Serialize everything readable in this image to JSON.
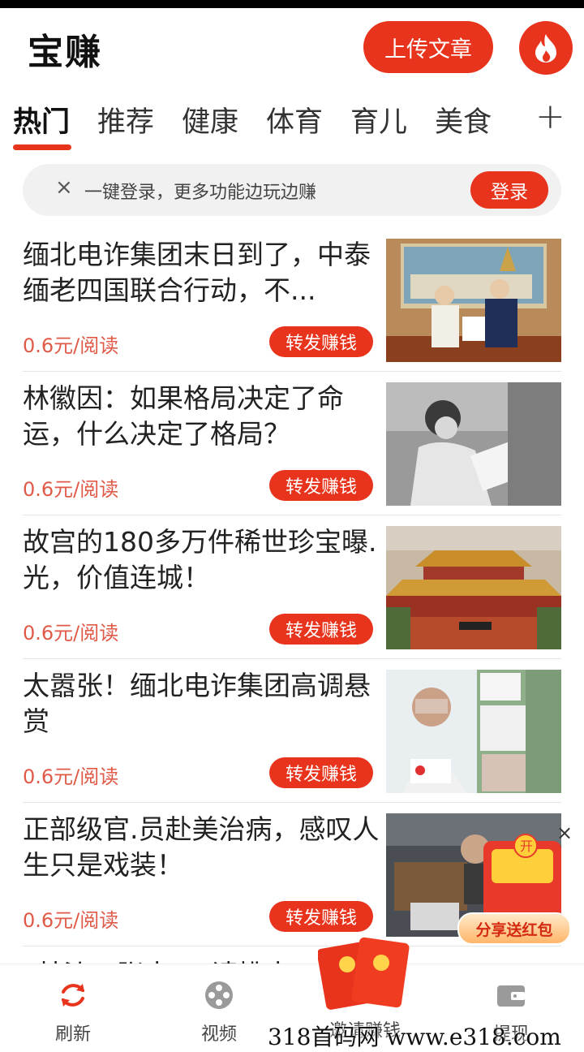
{
  "app": {
    "title": "宝赚",
    "upload_label": "上传文章",
    "accent": "#e8341c"
  },
  "tabs": [
    {
      "label": "热门",
      "active": true
    },
    {
      "label": "推荐"
    },
    {
      "label": "健康"
    },
    {
      "label": "体育"
    },
    {
      "label": "育儿"
    },
    {
      "label": "美食"
    }
  ],
  "tab_add": "+",
  "login_banner": {
    "close": "×",
    "text": "一键登录，更多功能边玩边赚",
    "button": "登录"
  },
  "feed": [
    {
      "title": "缅北电诈集团末日到了，中泰缅老四国联合行动，不...",
      "price": "0.6元/阅读",
      "share": "转发赚钱"
    },
    {
      "title": "林徽因：如果格局决定了命运，什么决定了格局？",
      "price": "0.6元/阅读",
      "share": "转发赚钱"
    },
    {
      "title": "故宫的180多万件稀世珍宝曝.光，价值连城！",
      "price": "0.6元/阅读",
      "share": "转发赚钱"
    },
    {
      "title": "太嚣张！缅北电诈集团高调悬赏",
      "price": "0.6元/阅读",
      "share": "转发赚钱"
    },
    {
      "title": "正部级官.员赴美治病，感叹人生只是戏装！",
      "price": "0.6元/阅读",
      "share": "转发赚钱"
    }
  ],
  "feed_peek_title": "“林沙…张大…”请挑出?",
  "ad": {
    "label": "分享送红包",
    "close": "×",
    "badge": "开"
  },
  "bottom_nav": [
    {
      "label": "刷新",
      "icon": "refresh-icon",
      "active": true
    },
    {
      "label": "视频",
      "icon": "film-reel-icon"
    },
    {
      "label": "邀请赚钱",
      "icon": "red-envelope-icon"
    },
    {
      "label": "提现",
      "icon": "wallet-icon"
    }
  ],
  "watermark": "318首码网 www.e318.com"
}
